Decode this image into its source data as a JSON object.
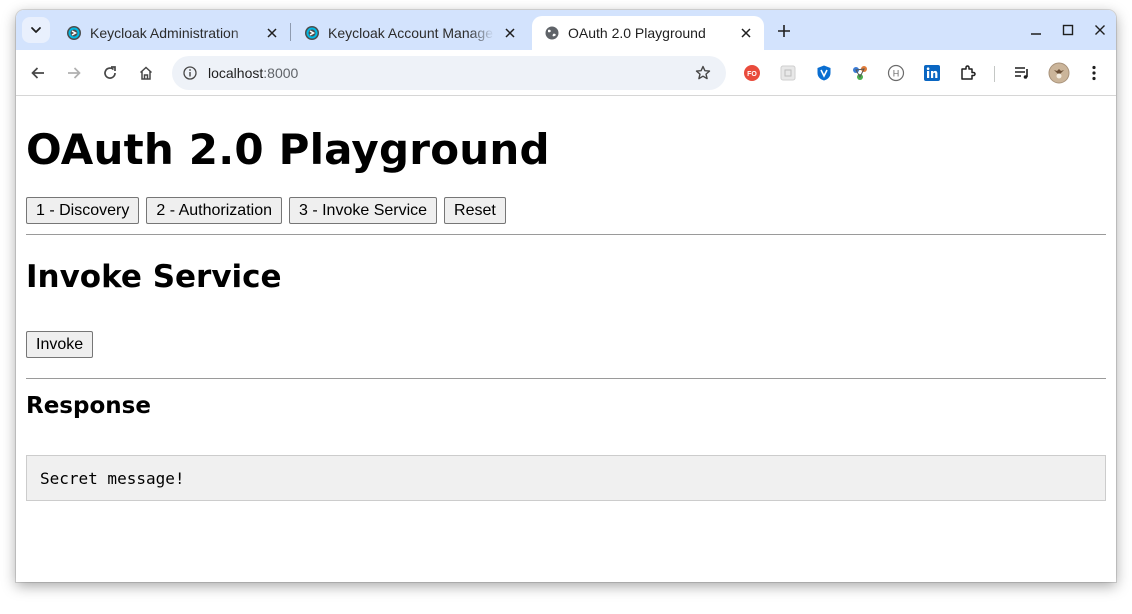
{
  "browser": {
    "tabs": [
      {
        "title": "Keycloak Administration",
        "icon": "keycloak-icon",
        "active": false
      },
      {
        "title": "Keycloak Account Management",
        "icon": "keycloak-icon",
        "active": false
      },
      {
        "title": "OAuth 2.0 Playground",
        "icon": "globe-icon",
        "active": true
      }
    ],
    "address": {
      "host": "localhost",
      "port": ":8000"
    },
    "extensions": [
      "fo-extension-icon",
      "grid-extension-icon",
      "shield-extension-icon",
      "molecule-extension-icon",
      "h-extension-icon",
      "linkedin-icon",
      "puzzle-extensions-icon",
      "reading-list-icon",
      "profile-avatar"
    ],
    "accent": "#d3e3fd"
  },
  "page": {
    "title": "OAuth 2.0 Playground",
    "steps": [
      "1 - Discovery",
      "2 - Authorization",
      "3 - Invoke Service",
      "Reset"
    ],
    "section_title": "Invoke Service",
    "invoke_label": "Invoke",
    "response_title": "Response",
    "response_body": "Secret message!"
  }
}
